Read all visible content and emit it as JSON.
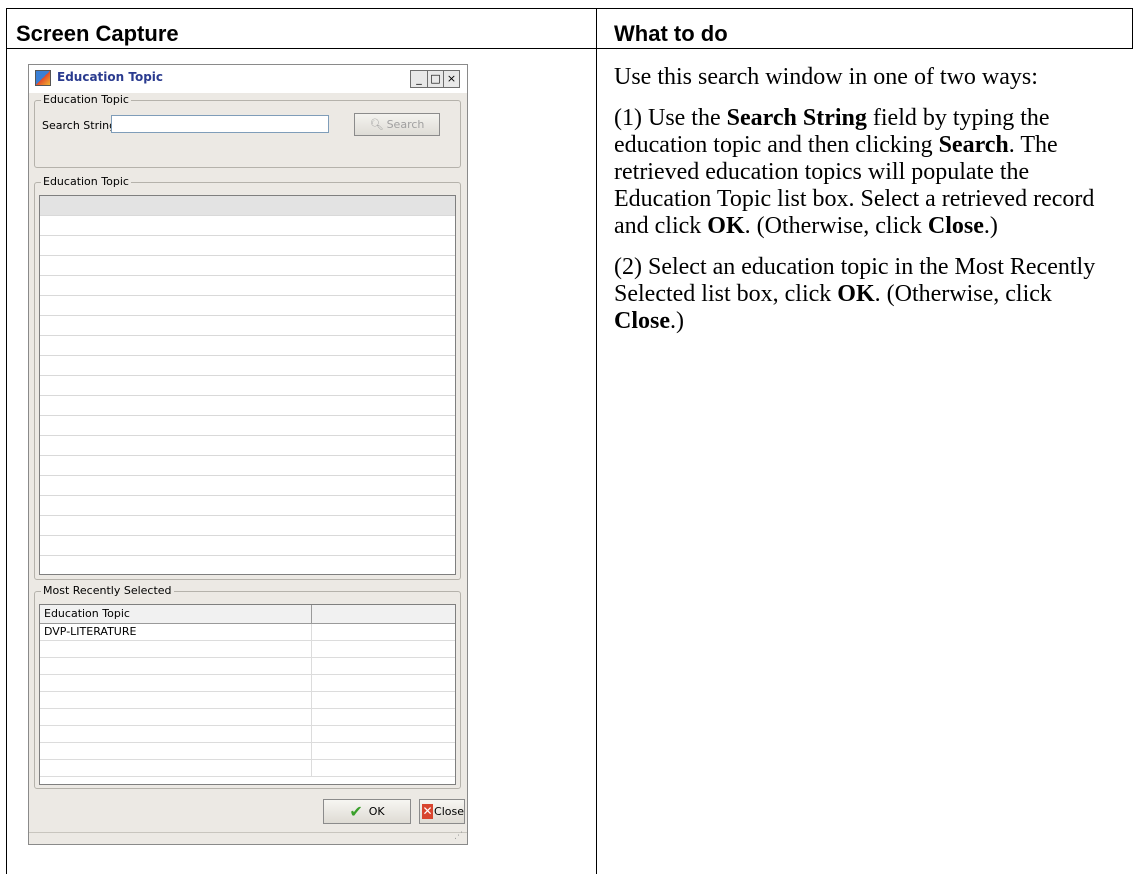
{
  "table": {
    "col1_header": "Screen Capture",
    "col2_header": "What to do"
  },
  "window": {
    "title": "Education Topic",
    "minimize_glyph": "_",
    "maximize_glyph": "□",
    "close_glyph": "×",
    "search_group_label": "Education Topic",
    "search_label": "Search String",
    "search_value": "",
    "search_button_label": "Search",
    "topic_group_label": "Education Topic",
    "recent_group_label": "Most Recently Selected",
    "recent_column_header": "Education Topic",
    "recent_items": [
      "DVP-LITERATURE",
      "",
      "",
      "",
      "",
      "",
      "",
      "",
      "",
      ""
    ],
    "ok_label": "OK",
    "close_label": "Close"
  },
  "instructions": {
    "p1": "Use this search window in one of two ways:",
    "p2_a": "(1) Use the ",
    "p2_b": "Search String",
    "p2_c": " field by typing the education topic and then clicking ",
    "p2_d": "Search",
    "p2_e": ". The retrieved education topics will populate the Education Topic list box. Select a retrieved record and click ",
    "p2_f": "OK",
    "p2_g": ". (Otherwise, click ",
    "p2_h": "Close",
    "p2_i": ".)",
    "p3_a": "(2) Select an education topic in the Most Recently Selected list box, click ",
    "p3_b": "OK",
    "p3_c": ". (Otherwise, click ",
    "p3_d": "Close",
    "p3_e": ".)"
  }
}
